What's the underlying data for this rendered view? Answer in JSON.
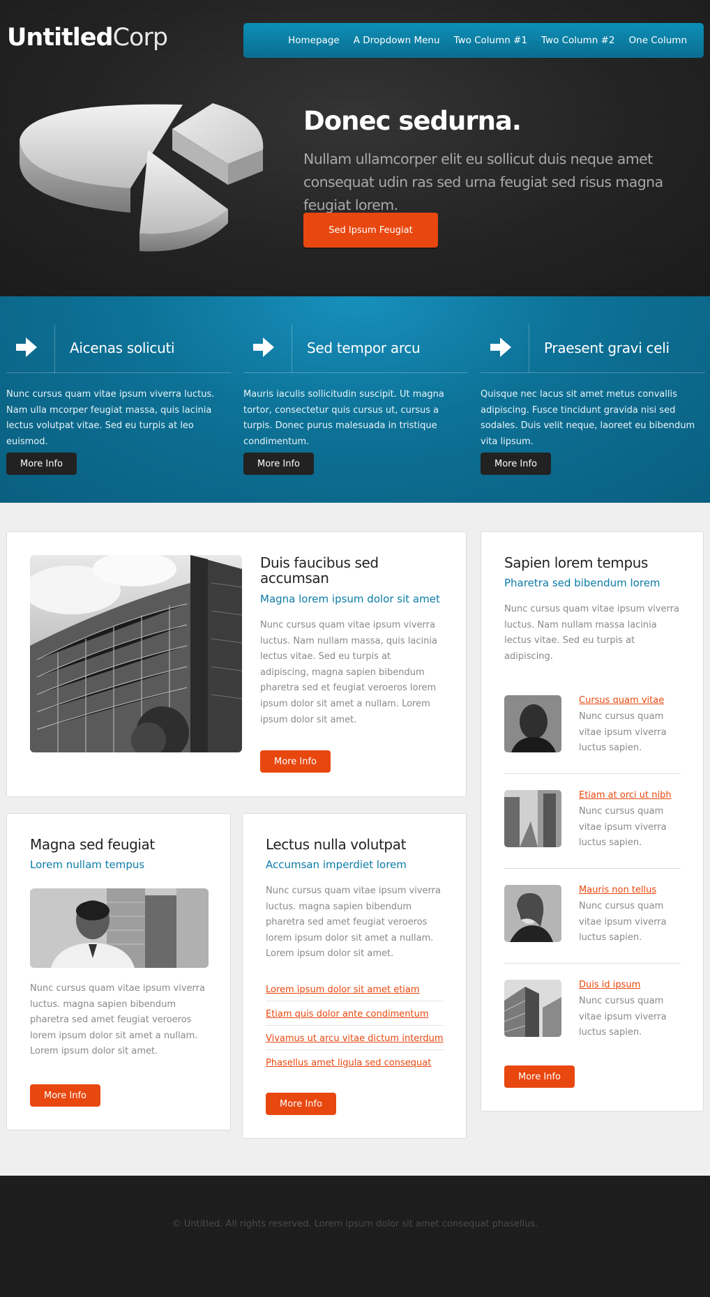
{
  "logo": {
    "bold": "Untitled",
    "light": "Corp"
  },
  "nav": {
    "items": [
      "Homepage",
      "A Dropdown Menu",
      "Two Column #1",
      "Two Column #2",
      "One Column"
    ]
  },
  "hero": {
    "title": "Donec sedurna.",
    "text": "Nullam ullamcorper elit eu sollicut duis neque amet consequat udin ras sed urna feugiat sed risus magna feugiat lorem.",
    "button": "Sed Ipsum Feugiat"
  },
  "features": [
    {
      "title": "Aicenas solicuti",
      "text": "Nunc cursus quam vitae ipsum viverra luctus. Nam ulla mcorper feugiat massa, quis lacinia lectus volutpat vitae. Sed eu turpis at leo euismod.",
      "button": "More Info"
    },
    {
      "title": "Sed tempor arcu",
      "text": "Mauris iaculis sollicitudin suscipit. Ut magna tortor, consectetur quis cursus ut, cursus a turpis. Donec purus malesuada in tristique condimentum.",
      "button": "More Info"
    },
    {
      "title": "Praesent gravi celi",
      "text": "Quisque nec lacus sit amet metus convallis adipiscing. Fusce tincidunt gravida nisi sed sodales. Duis velit neque, laoreet eu bibendum vita lipsum.",
      "button": "More Info"
    }
  ],
  "main_box": {
    "title": "Duis faucibus sed accumsan",
    "subtitle": "Magna lorem ipsum dolor sit amet",
    "text": "Nunc cursus quam vitae ipsum viverra luctus. Nam nullam massa, quis lacinia lectus vitae. Sed eu turpis at adipiscing, magna sapien bibendum pharetra sed et feugiat veroeros lorem ipsum dolor sit amet a nullam. Lorem ipsum dolor sit amet.",
    "button": "More Info"
  },
  "box_left": {
    "title": "Magna sed feugiat",
    "subtitle": "Lorem nullam tempus",
    "text": "Nunc cursus quam vitae ipsum viverra luctus. magna sapien bibendum pharetra sed amet feugiat veroeros lorem ipsum dolor sit amet a nullam. Lorem ipsum dolor sit amet.",
    "button": "More Info"
  },
  "box_mid": {
    "title": "Lectus nulla volutpat",
    "subtitle": "Accumsan imperdiet lorem",
    "text": "Nunc cursus quam vitae ipsum viverra luctus. magna sapien bibendum pharetra sed amet feugiat veroeros lorem ipsum dolor sit amet a nullam. Lorem ipsum dolor sit amet.",
    "links": [
      "Lorem ipsum dolor sit amet etiam",
      "Etiam quis dolor ante condimentum",
      "Vivamus ut arcu vitae dictum interdum",
      "Phasellus amet ligula sed consequat"
    ],
    "button": "More Info"
  },
  "sidebar": {
    "title": "Sapien lorem tempus",
    "subtitle": "Pharetra sed bibendum lorem",
    "text": "Nunc cursus quam vitae ipsum viverra luctus. Nam nullam massa lacinia lectus vitae. Sed eu turpis at adipiscing.",
    "items": [
      {
        "link": "Cursus quam vitae",
        "text": "Nunc cursus quam vitae ipsum viverra luctus sapien."
      },
      {
        "link": "Etiam at orci ut nibh",
        "text": "Nunc cursus quam vitae ipsum viverra luctus sapien."
      },
      {
        "link": "Mauris non tellus",
        "text": "Nunc cursus quam vitae ipsum viverra luctus sapien."
      },
      {
        "link": "Duis id ipsum",
        "text": "Nunc cursus quam vitae ipsum viverra luctus sapien."
      }
    ],
    "button": "More Info"
  },
  "footer": {
    "copyright": "© Untitled. All rights reserved. Lorem ipsum dolor sit amet consequat phasellus."
  },
  "colors": {
    "accent": "#e8470f",
    "blue": "#0c7ba8",
    "dark": "#1f1f1f"
  }
}
